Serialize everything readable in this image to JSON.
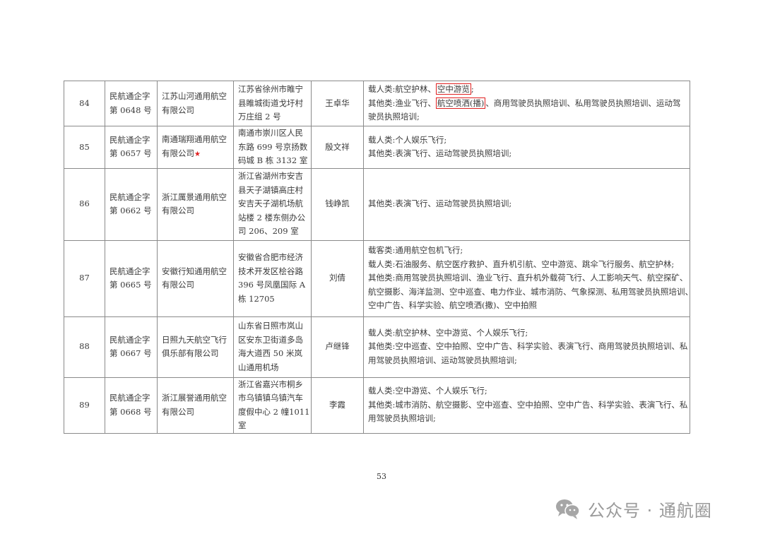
{
  "rows": [
    {
      "no": "84",
      "cert": [
        "民航通企字",
        "第 0648 号"
      ],
      "company": [
        "江苏山河通用航空",
        "有限公司"
      ],
      "star": false,
      "address": [
        "江苏省徐州市睢宁",
        "县睢城街道戈圩村",
        "万庄组 2 号"
      ],
      "person": "王卓华",
      "scope": [
        [
          "载人类:航空护林、",
          "空中游览",
          ";"
        ],
        [
          "其他类:渔业飞行、",
          "航空喷洒(播)",
          "、商用驾驶员执照培训、私用驾驶员执照培训、运动驾"
        ],
        [
          "驶员执照培训;"
        ]
      ]
    },
    {
      "no": "85",
      "cert": [
        "民航通企字",
        "第 0657 号"
      ],
      "company": [
        "南通瑞翔通用航空",
        "有限公司"
      ],
      "star": true,
      "address": [
        "南通市崇川区人民",
        "东路 699 号京扬数",
        "码城 B 栋 3132 室"
      ],
      "person": "殷文祥",
      "scope": [
        [
          "载人类:个人娱乐飞行;"
        ],
        [
          "其他类:表演飞行、运动驾驶员执照培训;"
        ]
      ]
    },
    {
      "no": "86",
      "cert": [
        "民航通企字",
        "第 0662 号"
      ],
      "company": [
        "浙江厲景通用航空",
        "有限公司"
      ],
      "star": false,
      "address": [
        "浙江省湖州市安吉",
        "县天子湖镇高庄村",
        "安吉天子湖机场航",
        "站楼 2 楼东侧办公",
        "司 206、209 室"
      ],
      "person": "钱峥凯",
      "scope": [
        [
          "其他类:表演飞行、运动驾驶员执照培训;"
        ]
      ]
    },
    {
      "no": "87",
      "cert": [
        "民航通企字",
        "第 0665 号"
      ],
      "company": [
        "安徽行知通用航空",
        "有限公司"
      ],
      "star": false,
      "address": [
        "安徽省合肥市经济",
        "技术开发区桧谷路",
        "396 号凤凰国际 A",
        "栋 12705"
      ],
      "person": "刘倩",
      "scope": [
        [
          "载客类:通用航空包机飞行;"
        ],
        [
          "载人类:石油服务、航空医疗救护、直升机引航、空中游览、跳伞飞行服务、航空护林;"
        ],
        [
          "其他类:商用驾驶员执照培训、渔业飞行、直升机外载荷飞行、人工影响天气、航空探矿、"
        ],
        [
          "航空摄影、海洋监测、空中巡查、电力作业、城市消防、气象探测、私用驾驶员执照培训、"
        ],
        [
          "空中广告、科学实验、航空喷洒(撒)、空中拍照"
        ]
      ]
    },
    {
      "no": "88",
      "cert": [
        "民航通企字",
        "第 0667 号"
      ],
      "company": [
        "日照九天航空飞行",
        "俱乐部有限公司"
      ],
      "star": false,
      "address": [
        "山东省日照市岚山",
        "区安东卫街道多岛",
        "海大道西 50 米岚",
        "山通用机场"
      ],
      "person": "卢继锋",
      "scope": [
        [
          "载人类:航空护林、空中游览、个人娱乐飞行;"
        ],
        [
          "其他类:空中巡查、空中拍照、空中广告、科学实验、表演飞行、商用驾驶员执照培训、私"
        ],
        [
          "用驾驶员执照培训、运动驾驶员执照培训;"
        ]
      ]
    },
    {
      "no": "89",
      "cert": [
        "民航通企字",
        "第 0668 号"
      ],
      "company": [
        "浙江展誉通用航空",
        "有限公司"
      ],
      "star": false,
      "address": [
        "浙江省嘉兴市桐乡",
        "市乌镇镇乌镇汽车",
        "度假中心 2 幢1011",
        "室"
      ],
      "person": "李霞",
      "scope": [
        [
          "载人类:空中游览、个人娱乐飞行;"
        ],
        [
          "其他类:城市消防、航空摄影、空中巡查、空中拍照、空中广告、科学实验、表演飞行、私"
        ],
        [
          "用驾驶员执照培训;"
        ]
      ]
    }
  ],
  "page_number": "53",
  "watermark": {
    "text": "公众号 · 通航圈",
    "icon": "wechat-icon"
  },
  "colors": {
    "highlight_box": "#e02020",
    "star": "#e02020",
    "border": "#8a8a8a"
  }
}
